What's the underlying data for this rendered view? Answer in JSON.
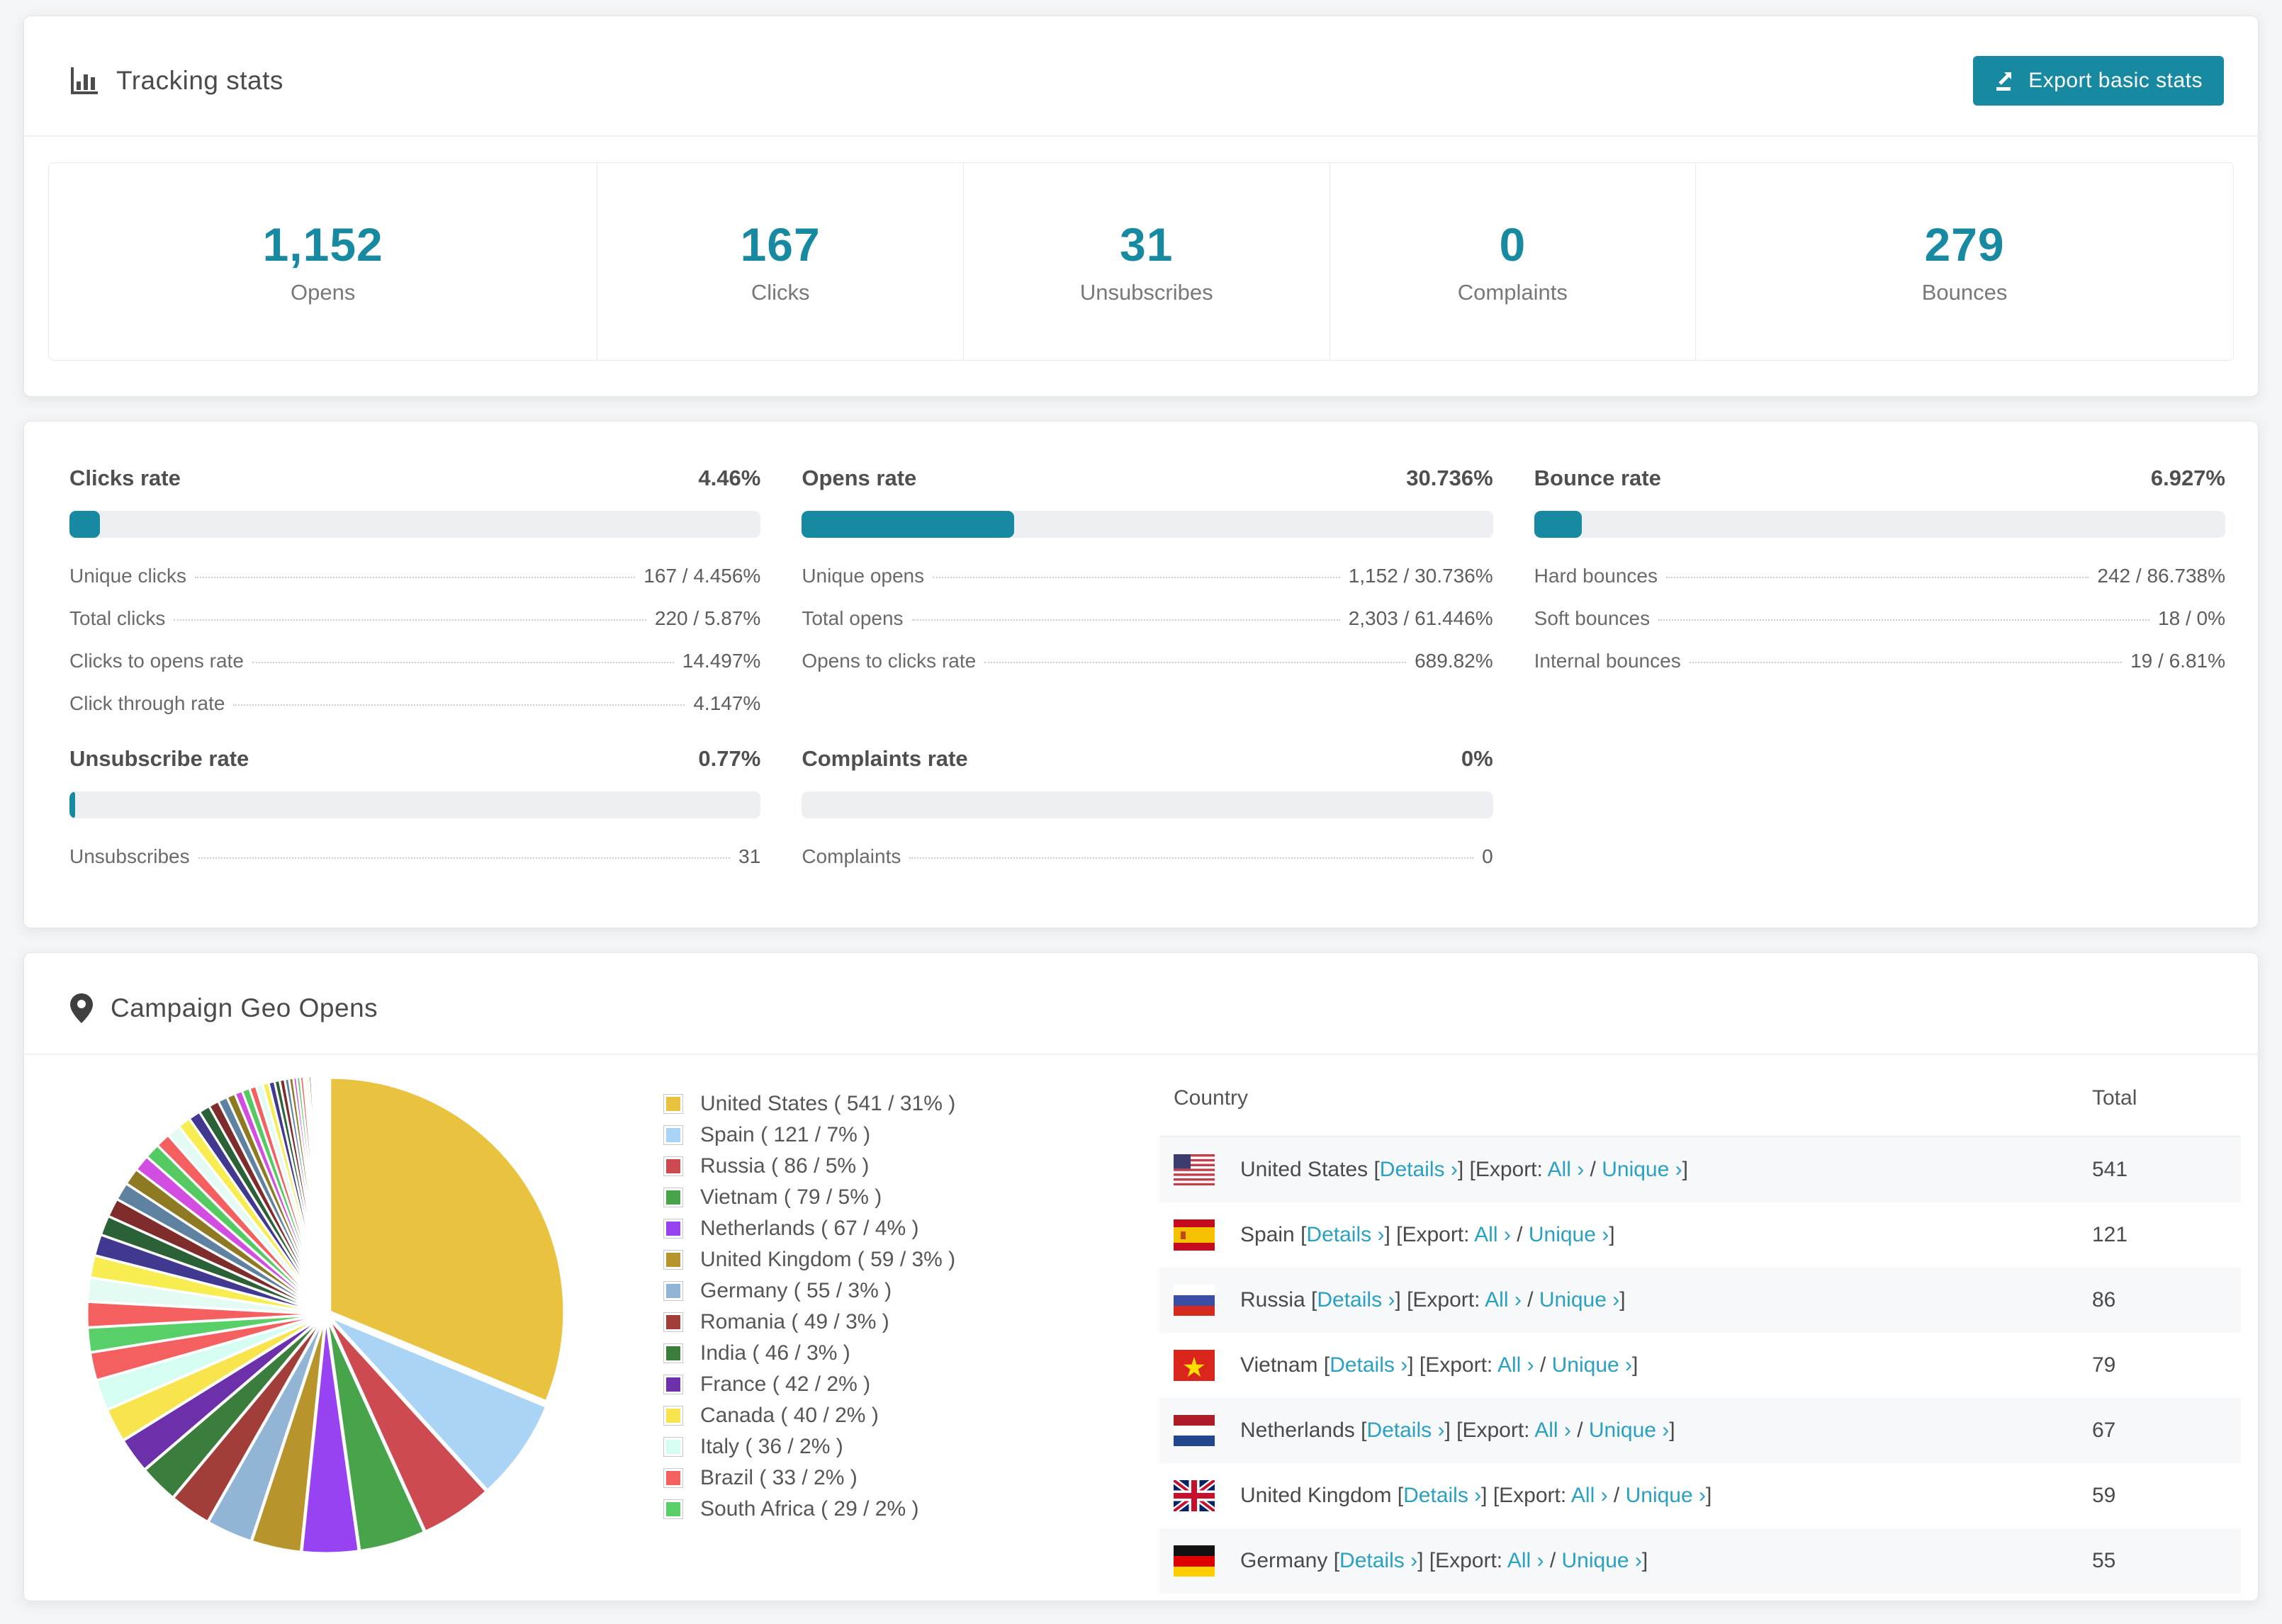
{
  "accent_color": "#1789a1",
  "link_color": "#2aa0c2",
  "header": {
    "title": "Tracking stats",
    "export_label": "Export basic stats"
  },
  "summary": [
    {
      "value": "1,152",
      "label": "Opens"
    },
    {
      "value": "167",
      "label": "Clicks"
    },
    {
      "value": "31",
      "label": "Unsubscribes"
    },
    {
      "value": "0",
      "label": "Complaints"
    },
    {
      "value": "279",
      "label": "Bounces"
    }
  ],
  "rates": {
    "blocks": [
      {
        "key": "clicks",
        "title": "Clicks rate",
        "value": "4.46%",
        "percent": 4.46,
        "rows": [
          {
            "label": "Unique clicks",
            "value": "167 / 4.456%"
          },
          {
            "label": "Total clicks",
            "value": "220 / 5.87%"
          },
          {
            "label": "Clicks to opens rate",
            "value": "14.497%"
          },
          {
            "label": "Click through rate",
            "value": "4.147%"
          }
        ]
      },
      {
        "key": "opens",
        "title": "Opens rate",
        "value": "30.736%",
        "percent": 30.736,
        "rows": [
          {
            "label": "Unique opens",
            "value": "1,152 / 30.736%"
          },
          {
            "label": "Total opens",
            "value": "2,303 / 61.446%"
          },
          {
            "label": "Opens to clicks rate",
            "value": "689.82%"
          }
        ]
      },
      {
        "key": "bounce",
        "title": "Bounce rate",
        "value": "6.927%",
        "percent": 6.927,
        "rows": [
          {
            "label": "Hard bounces",
            "value": "242 / 86.738%"
          },
          {
            "label": "Soft bounces",
            "value": "18 / 0%"
          },
          {
            "label": "Internal bounces",
            "value": "19 / 6.81%"
          }
        ]
      },
      {
        "key": "unsubscribe",
        "title": "Unsubscribe rate",
        "value": "0.77%",
        "percent": 0.77,
        "rows": [
          {
            "label": "Unsubscribes",
            "value": "31"
          }
        ]
      },
      {
        "key": "complaints",
        "title": "Complaints rate",
        "value": "0%",
        "percent": 0,
        "rows": [
          {
            "label": "Complaints",
            "value": "0"
          }
        ]
      }
    ]
  },
  "geo": {
    "title": "Campaign Geo Opens",
    "links": {
      "open_bracket": "[",
      "close_bracket": "]",
      "details": "Details ›",
      "export": "Export:",
      "all": "All ›",
      "slash": "/",
      "unique": "Unique ›"
    },
    "table": {
      "columns": [
        "Country",
        "Total"
      ],
      "rows": [
        {
          "flag": "us",
          "country": "United States",
          "total": "541"
        },
        {
          "flag": "es",
          "country": "Spain",
          "total": "121"
        },
        {
          "flag": "ru",
          "country": "Russia",
          "total": "86"
        },
        {
          "flag": "vn",
          "country": "Vietnam",
          "total": "79"
        },
        {
          "flag": "nl",
          "country": "Netherlands",
          "total": "67"
        },
        {
          "flag": "gb",
          "country": "United Kingdom",
          "total": "59"
        },
        {
          "flag": "de",
          "country": "Germany",
          "total": "55"
        }
      ]
    }
  },
  "chart_data": {
    "type": "pie",
    "title": "Campaign Geo Opens",
    "legend_position": "right",
    "start_angle_deg": -90,
    "direction": "clockwise",
    "labels": [
      "United States",
      "Spain",
      "Russia",
      "Vietnam",
      "Netherlands",
      "United Kingdom",
      "Germany",
      "Romania",
      "India",
      "France",
      "Canada",
      "Italy",
      "Brazil",
      "South Africa"
    ],
    "values": [
      541,
      121,
      86,
      79,
      67,
      59,
      55,
      49,
      46,
      42,
      40,
      36,
      33,
      29
    ],
    "percents": [
      31,
      7,
      5,
      5,
      4,
      3,
      3,
      3,
      3,
      2,
      2,
      2,
      2,
      2
    ],
    "colors": [
      "#e9c23f",
      "#aad4f5",
      "#cc4a50",
      "#47a44b",
      "#9843f1",
      "#b8952c",
      "#92b4d5",
      "#a13e3a",
      "#3a7d3d",
      "#6c30aa",
      "#f8e44c",
      "#d5fdf2",
      "#f4605f",
      "#58cf68"
    ],
    "others_values": [
      30,
      28,
      26,
      25,
      23,
      22,
      21,
      20,
      19,
      18,
      17,
      16,
      15,
      14,
      13,
      12,
      11,
      10,
      9,
      9,
      8,
      8,
      7,
      7,
      6,
      6,
      5,
      5,
      4,
      4,
      4,
      3,
      3,
      3,
      2,
      2,
      2,
      2,
      2,
      1,
      1,
      1,
      1,
      1,
      1,
      1
    ],
    "others_palette": [
      "#f4605f",
      "#e4fbf4",
      "#f7ec50",
      "#41388f",
      "#2a6136",
      "#7e2c2c",
      "#5e82a0",
      "#8f7a24",
      "#d24ee0",
      "#55ca62"
    ]
  }
}
